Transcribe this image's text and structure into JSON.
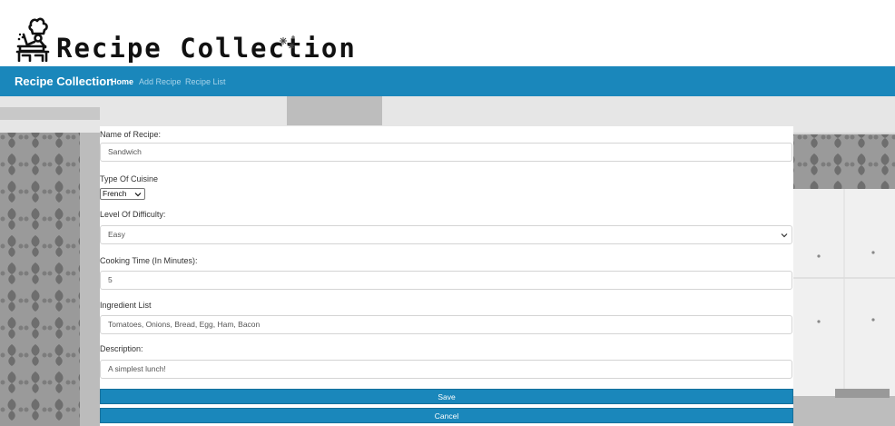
{
  "logo": {
    "title": "Recipe Collection",
    "chef_icon": "chef-stirring-pot-icon",
    "sparkle_icon": "sparkle-icon"
  },
  "navbar": {
    "brand": "Recipe Collection",
    "links": [
      "Home",
      "Add Recipe",
      "Recipe List"
    ],
    "active": "Home",
    "color": "#1a87bb"
  },
  "form": {
    "name": {
      "label": "Name of Recipe:",
      "value": "Sandwich"
    },
    "cuisine": {
      "label": "Type Of Cuisine",
      "value": "French"
    },
    "difficulty": {
      "label": "Level Of Difficulty:",
      "value": "Easy"
    },
    "cooking_time": {
      "label": "Cooking Time (In Minutes):",
      "value": "5"
    },
    "ingredients": {
      "label": "Ingredient List",
      "value": "Tomatoes, Onions, Bread, Egg, Ham, Bacon"
    },
    "description": {
      "label": "Description:",
      "value": "A simplest lunch!"
    },
    "save_label": "Save",
    "cancel_label": "Cancel"
  }
}
